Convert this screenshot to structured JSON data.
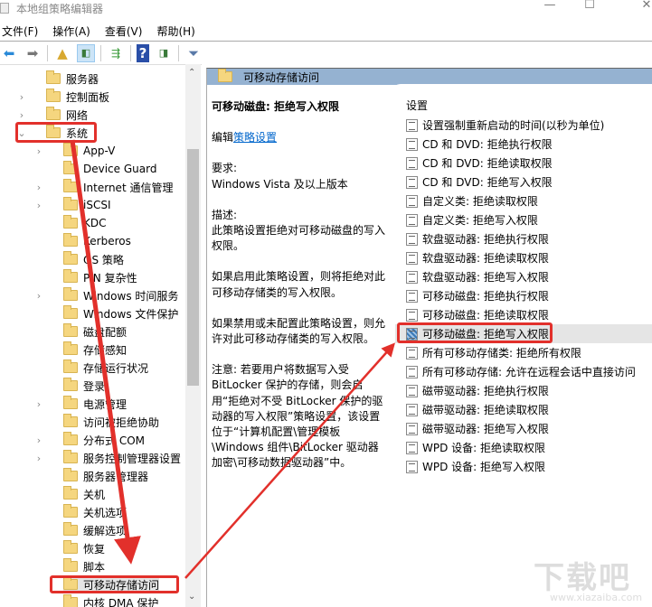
{
  "window": {
    "title": "本地组策略编辑器",
    "minimize": "—",
    "maximize": "☐",
    "close": "✕"
  },
  "menu": [
    "文件(F)",
    "操作(A)",
    "查看(V)",
    "帮助(H)"
  ],
  "tree": [
    {
      "label": "服务器",
      "chev": ""
    },
    {
      "label": "控制面板",
      "chev": "›"
    },
    {
      "label": "网络",
      "chev": "›"
    },
    {
      "label": "系统",
      "chev": "⌄"
    },
    {
      "label": "App-V",
      "chev": "›"
    },
    {
      "label": "Device Guard",
      "chev": ""
    },
    {
      "label": "Internet 通信管理",
      "chev": "›"
    },
    {
      "label": "iSCSI",
      "chev": "›"
    },
    {
      "label": "KDC",
      "chev": ""
    },
    {
      "label": "Kerberos",
      "chev": ""
    },
    {
      "label": "OS 策略",
      "chev": ""
    },
    {
      "label": "PIN 复杂性",
      "chev": ""
    },
    {
      "label": "Windows 时间服务",
      "chev": "›"
    },
    {
      "label": "Windows 文件保护",
      "chev": ""
    },
    {
      "label": "磁盘配额",
      "chev": ""
    },
    {
      "label": "存储感知",
      "chev": ""
    },
    {
      "label": "存储运行状况",
      "chev": ""
    },
    {
      "label": "登录",
      "chev": ""
    },
    {
      "label": "电源管理",
      "chev": "›"
    },
    {
      "label": "访问被拒绝协助",
      "chev": ""
    },
    {
      "label": "分布式 COM",
      "chev": "›"
    },
    {
      "label": "服务控制管理器设置",
      "chev": "›"
    },
    {
      "label": "服务器管理器",
      "chev": ""
    },
    {
      "label": "关机",
      "chev": ""
    },
    {
      "label": "关机选项",
      "chev": ""
    },
    {
      "label": "缓解选项",
      "chev": ""
    },
    {
      "label": "恢复",
      "chev": ""
    },
    {
      "label": "脚本",
      "chev": ""
    },
    {
      "label": "可移动存储访问",
      "chev": ""
    },
    {
      "label": "内核 DMA 保护",
      "chev": ""
    }
  ],
  "header": {
    "title": "可移动存储访问"
  },
  "description": {
    "title": "可移动磁盘: 拒绝写入权限",
    "edit_prefix": "编辑",
    "edit_link": "策略设置",
    "req_label": "要求:",
    "req_value": "Windows Vista 及以上版本",
    "desc_label": "描述:",
    "desc_text": "此策略设置拒绝对可移动磁盘的写入权限。",
    "enabled_text": "如果启用此策略设置，则将拒绝对此可移动存储类的写入权限。",
    "disabled_text": "如果禁用或未配置此策略设置，则允许对此可移动存储类的写入权限。",
    "note_text": "注意: 若要用户将数据写入受 BitLocker 保护的存储，则会启用“拒绝对不受 BitLocker 保护的驱动器的写入权限”策略设置，该设置位于“计算机配置\\管理模板\\Windows 组件\\BitLocker 驱动器加密\\可移动数据驱动器”中。"
  },
  "settings": {
    "header": "设置",
    "items": [
      "设置强制重新启动的时间(以秒为单位)",
      "CD 和 DVD: 拒绝执行权限",
      "CD 和 DVD: 拒绝读取权限",
      "CD 和 DVD: 拒绝写入权限",
      "自定义类: 拒绝读取权限",
      "自定义类: 拒绝写入权限",
      "软盘驱动器: 拒绝执行权限",
      "软盘驱动器: 拒绝读取权限",
      "软盘驱动器: 拒绝写入权限",
      "可移动磁盘: 拒绝执行权限",
      "可移动磁盘: 拒绝读取权限",
      "可移动磁盘: 拒绝写入权限",
      "所有可移动存储类: 拒绝所有权限",
      "所有可移动存储: 允许在远程会话中直接访问",
      "磁带驱动器: 拒绝执行权限",
      "磁带驱动器: 拒绝读取权限",
      "磁带驱动器: 拒绝写入权限",
      "WPD 设备: 拒绝读取权限",
      "WPD 设备: 拒绝写入权限"
    ],
    "selected_index": 11
  },
  "watermark": {
    "text": "下载吧",
    "url": "www.xiazaiba.com"
  },
  "colors": {
    "header": "#95b2d1",
    "annotation": "#e2302b"
  }
}
